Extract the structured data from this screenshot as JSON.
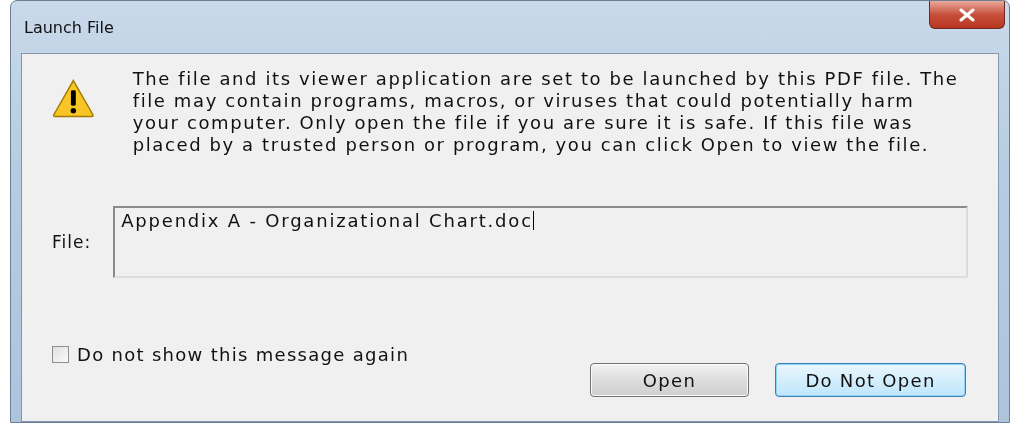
{
  "window": {
    "title": "Launch File"
  },
  "message": "The file and its viewer application are set to be launched by this PDF file. The file may contain programs, macros, or viruses that could potentially harm your computer. Only open the file if you are sure it is safe. If this file was placed by a trusted person or program, you can click Open to view the file.",
  "file": {
    "label": "File:",
    "value": "Appendix A - Organizational Chart.doc"
  },
  "checkbox": {
    "label": "Do not show this message again",
    "checked": false
  },
  "buttons": [
    {
      "label": "Open",
      "default": false
    },
    {
      "label": "Do Not Open",
      "default": true
    }
  ]
}
